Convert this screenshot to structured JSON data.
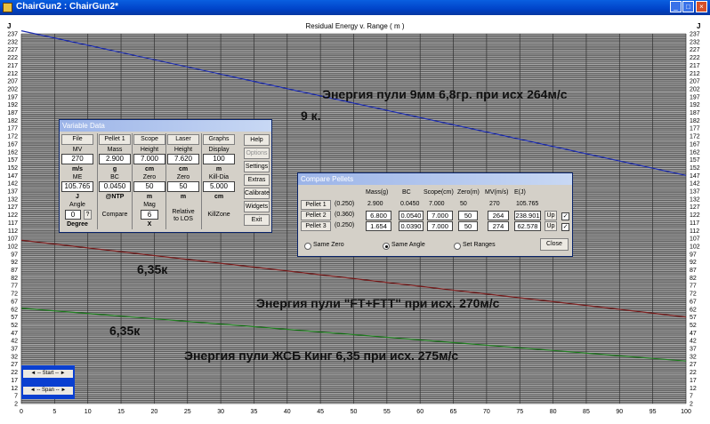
{
  "window": {
    "title": "ChairGun2 : ChairGun2*",
    "icon": "app-icon"
  },
  "chart_data": {
    "type": "line",
    "title": "Residual Energy v. Range ( m )",
    "ylabel": "J",
    "xlim": [
      0,
      100
    ],
    "ylim": [
      2,
      237
    ],
    "x_ticks": [
      0,
      5,
      10,
      15,
      20,
      25,
      30,
      35,
      40,
      45,
      50,
      55,
      60,
      65,
      70,
      75,
      80,
      85,
      90,
      95,
      100
    ],
    "y_ticks": [
      237,
      232,
      227,
      222,
      217,
      212,
      207,
      202,
      197,
      192,
      187,
      182,
      177,
      172,
      167,
      162,
      157,
      152,
      147,
      142,
      137,
      132,
      127,
      122,
      117,
      112,
      107,
      102,
      97,
      92,
      87,
      82,
      77,
      72,
      67,
      62,
      57,
      52,
      47,
      42,
      37,
      32,
      27,
      22,
      17,
      12,
      7,
      2
    ],
    "grid": true,
    "series": [
      {
        "color": "#1c2cb0",
        "x": [
          0,
          100
        ],
        "y": [
          238.9,
          147
        ]
      },
      {
        "color": "#7a1c1c",
        "x": [
          0,
          100
        ],
        "y": [
          105.8,
          57
        ]
      },
      {
        "color": "#1e7e1e",
        "x": [
          0,
          100
        ],
        "y": [
          62.6,
          29
        ]
      }
    ]
  },
  "annotations": [
    "Энергия пули 9мм 6,8гр. при исх 264м/с",
    "9 к.",
    "6,35к",
    "Энергия пули \"FT+FTT\" при исх. 270м/с",
    "6,35к",
    "Энергия пули ЖСБ Кинг 6,35 при исх. 275м/с"
  ],
  "variable_data": {
    "title": "Variable Data",
    "columns": [
      {
        "button": "File",
        "label1": "MV",
        "value1": "270",
        "unit1": "m/s",
        "label2": "ME",
        "value2": "105.765",
        "unit2": "J",
        "label3": "Angle",
        "value3": "0",
        "help": "?",
        "unit3": "Degree"
      },
      {
        "button": "Pellet 1",
        "label1": "Mass",
        "value1": "2.900",
        "unit1": "g",
        "label2": "BC",
        "value2": "0.0450",
        "unit2": "@NTP",
        "action": "Compare"
      },
      {
        "button": "Scope",
        "label1": "Height",
        "value1": "7.000",
        "unit1": "cm",
        "label2": "Zero",
        "value2": "50",
        "unit2": "m",
        "label3": "Mag",
        "value3": "6",
        "unit3": "X"
      },
      {
        "button": "Laser",
        "label1": "Height",
        "value1": "7.620",
        "unit1": "cm",
        "label2": "Zero",
        "value2": "50",
        "unit2": "m",
        "note1": "Relative",
        "note2": "to LOS"
      },
      {
        "button": "Graphs",
        "label1": "Display",
        "value1": "100",
        "unit1": "m",
        "label2": "Kill-Dia",
        "value2": "5.000",
        "unit2": "cm",
        "action": "KillZone"
      }
    ],
    "side_buttons": [
      "Help",
      "Options",
      "Settings",
      "Extras",
      "Calibrate",
      "Widgets",
      "Exit"
    ]
  },
  "compare": {
    "title": "Compare Pellets",
    "headers": [
      "Mass(g)",
      "BC",
      "Scope(cm)",
      "Zero(m)",
      "MV(m/s)",
      "E(J)"
    ],
    "rows": [
      {
        "name": "Pellet 1",
        "cal": "(0.250)",
        "mass": "2.900",
        "bc": "0.0450",
        "scope": "7.000",
        "zero": "50",
        "mv": "270",
        "e": "105.765"
      },
      {
        "name": "Pellet 2",
        "cal": "(0.360)",
        "mass": "6.800",
        "bc": "0.0540",
        "scope": "7.000",
        "zero": "50",
        "mv": "264",
        "e": "238.901",
        "up": "Up",
        "check": "✓"
      },
      {
        "name": "Pellet 3",
        "cal": "(0.250)",
        "mass": "1.654",
        "bc": "0.0390",
        "scope": "7.000",
        "zero": "50",
        "mv": "274",
        "e": "62.578",
        "up": "Up",
        "check": "✓"
      }
    ],
    "options": [
      "Same Zero",
      "Same Angle",
      "Set Ranges"
    ],
    "selected": "Same Angle",
    "close": "Close"
  },
  "nav": {
    "start": "-- Start --",
    "span": "-- Span --",
    "left": "◄",
    "right": "►"
  }
}
